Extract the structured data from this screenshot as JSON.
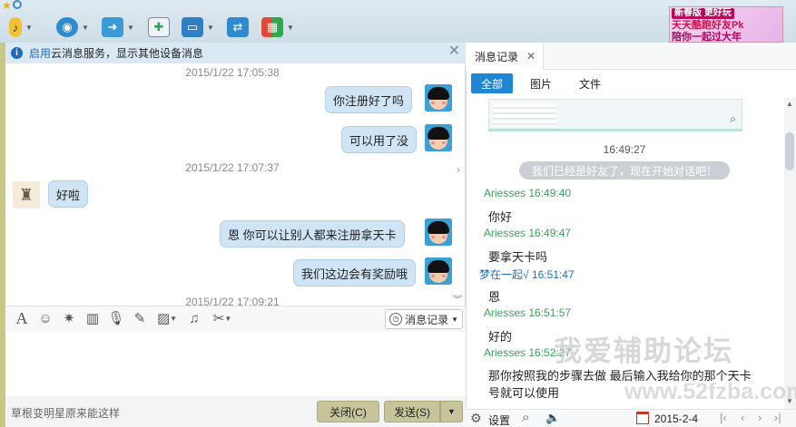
{
  "toolbar": {
    "icons": [
      "microphone-icon",
      "video-icon",
      "folder-transfer-icon",
      "add-chat-icon",
      "screen-share-icon",
      "remote-assist-icon",
      "apps-grid-icon"
    ]
  },
  "banner": {
    "line1": "新春版 更好玩",
    "line2": "天天酷跑好友Pk",
    "line3": "陪你一起过大年"
  },
  "notice": {
    "link": "启用",
    "text": "云消息服务，显示其他设备消息"
  },
  "chat": {
    "messages": [
      {
        "type": "time",
        "text": "2015/1/22 17:05:38"
      },
      {
        "type": "out",
        "text": "你注册好了吗"
      },
      {
        "type": "out",
        "text": "可以用了没"
      },
      {
        "type": "time",
        "text": "2015/1/22 17:07:37"
      },
      {
        "type": "in",
        "text": "好啦"
      },
      {
        "type": "out",
        "text": "恩 你可以让别人都来注册拿天卡"
      },
      {
        "type": "out",
        "text": "我们这边会有奖励哦"
      },
      {
        "type": "time",
        "text": "2015/1/22 17:09:21"
      }
    ]
  },
  "input_toolbar": {
    "history_label": "消息记录"
  },
  "footer": {
    "hint": "草根变明星原来能这样",
    "close_label": "关闭(C)",
    "send_label": "发送(S)"
  },
  "history": {
    "tab_label": "消息记录",
    "filters": [
      "全部",
      "图片",
      "文件"
    ],
    "active_filter": "全部",
    "system_time": "16:49:27",
    "system_msg": "我们已经是好友了，现在开始对话吧！",
    "entries": [
      {
        "sender": "Ariesses",
        "time": "16:49:40",
        "text": "你好",
        "me": false
      },
      {
        "sender": "Ariesses",
        "time": "16:49:47",
        "text": "要拿天卡吗",
        "me": false
      },
      {
        "sender": "梦在一起√",
        "time": "16:51:47",
        "text": "恩",
        "me": true
      },
      {
        "sender": "Ariesses",
        "time": "16:51:57",
        "text": "好的",
        "me": false
      },
      {
        "sender": "Ariesses",
        "time": "16:52:27",
        "text": "那你按照我的步骤去做 最后输入我给你的那个天卡号就可以使用",
        "me": false
      }
    ],
    "settings_label": "设置",
    "date": "2015-2-4"
  },
  "watermark": {
    "line1": "我爱辅助论坛",
    "line2": "www.52fzba.com"
  },
  "colors": {
    "accent": "#1f86d4",
    "bubble": "#cfe4f5",
    "sender": "#3aa15a",
    "button": "#c6c49a"
  }
}
